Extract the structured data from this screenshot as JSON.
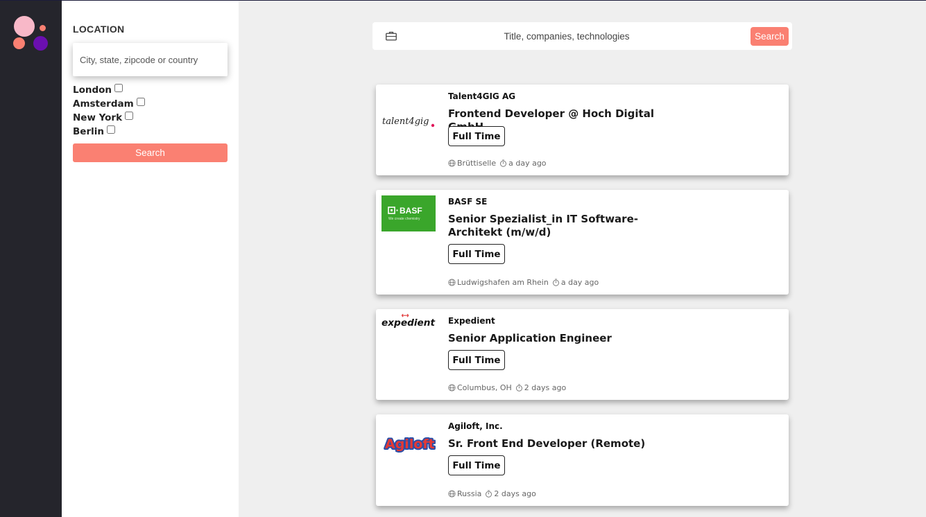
{
  "colors": {
    "accent": "#fa8072",
    "rail": "#25252c",
    "page_bg": "#efefef"
  },
  "filter": {
    "title": "LOCATION",
    "location_placeholder": "City, state, zipcode or country",
    "cities": [
      "London",
      "Amsterdam",
      "New York",
      "Berlin"
    ],
    "search_label": "Search"
  },
  "search": {
    "icon": "briefcase-icon",
    "placeholder": "Title, companies, technologies",
    "button_label": "Search"
  },
  "jobs": [
    {
      "company": "Talent4GIG AG",
      "title": "Frontend Developer @ Hoch Digital GmbH",
      "type": "Full Time",
      "location": "Brüttiselle",
      "posted": "a day ago",
      "logo_text": "talent4gig"
    },
    {
      "company": "BASF SE",
      "title": "Senior Spezialist_in IT Software-Architekt (m/w/d)",
      "type": "Full Time",
      "location": "Ludwigshafen am Rhein",
      "posted": "a day ago",
      "logo_text": "BASF",
      "logo_sub": "We create chemistry"
    },
    {
      "company": "Expedient",
      "title": "Senior Application Engineer",
      "type": "Full Time",
      "location": "Columbus, OH",
      "posted": "2 days ago",
      "logo_text": "expedient"
    },
    {
      "company": "Agiloft, Inc.",
      "title": "Sr. Front End Developer (Remote)",
      "type": "Full Time",
      "location": "Russia",
      "posted": "2 days ago",
      "logo_text": "Agiloft"
    }
  ]
}
